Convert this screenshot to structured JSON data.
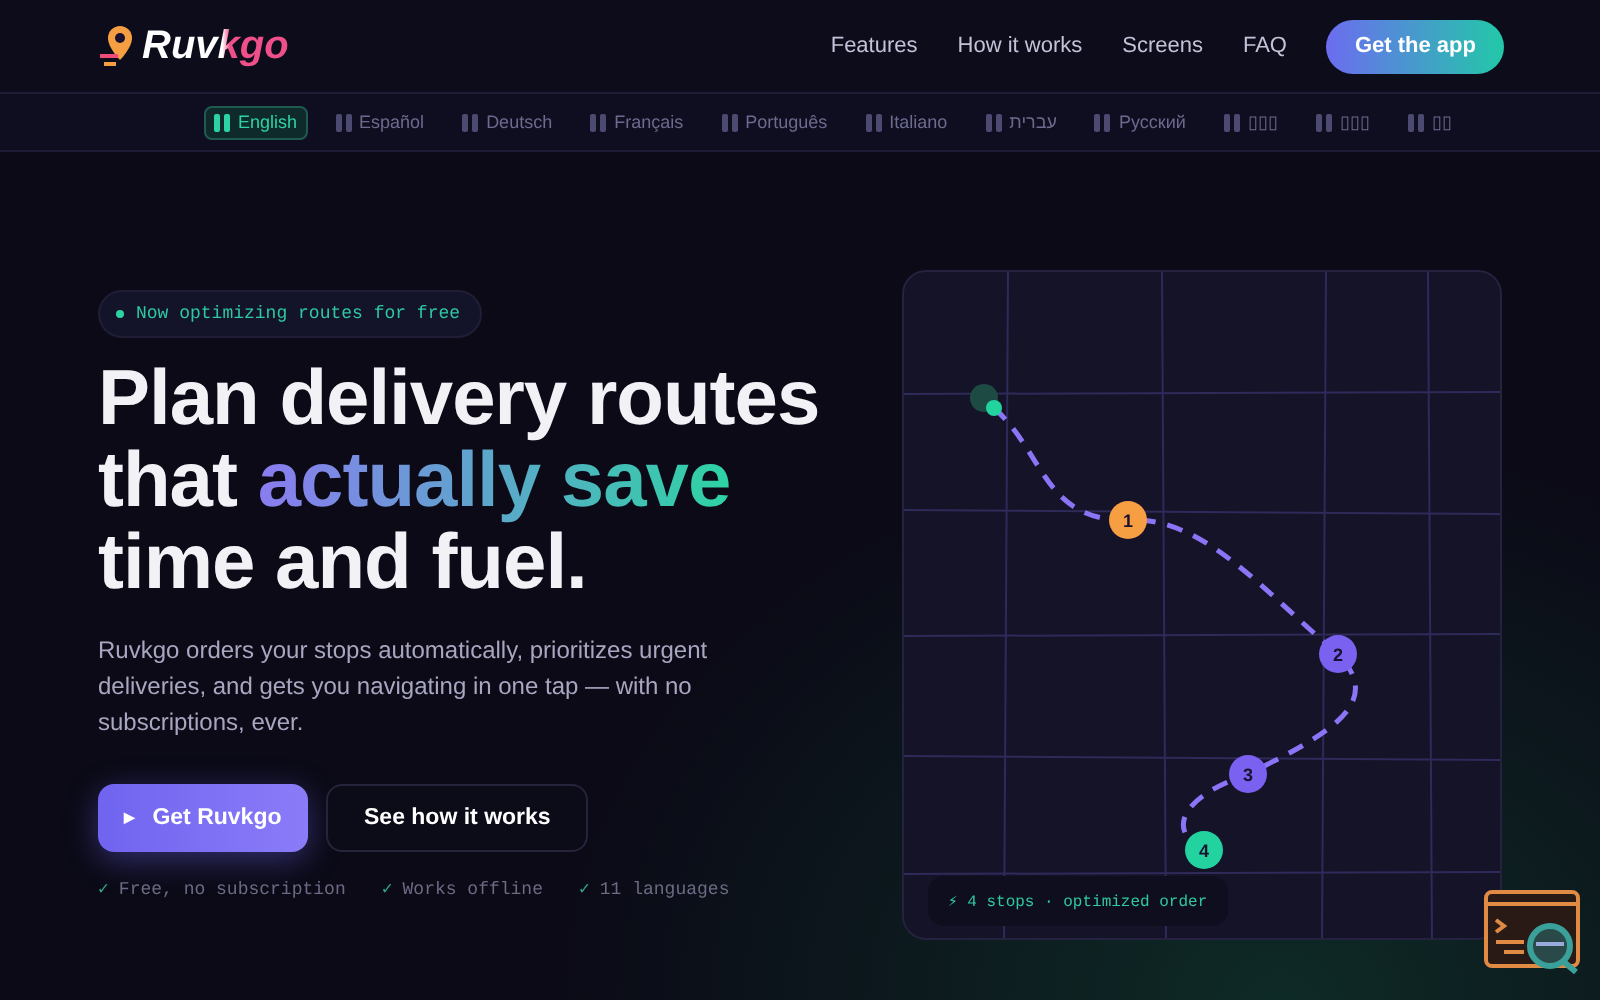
{
  "header": {
    "logo": "Ruvkgo",
    "nav": [
      {
        "label": "Features"
      },
      {
        "label": "How it works"
      },
      {
        "label": "Screens"
      },
      {
        "label": "FAQ"
      }
    ],
    "cta": "Get the app"
  },
  "languages": [
    {
      "label": "English",
      "selected": true
    },
    {
      "label": "Español",
      "selected": false
    },
    {
      "label": "Deutsch",
      "selected": false
    },
    {
      "label": "Français",
      "selected": false
    },
    {
      "label": "Português",
      "selected": false
    },
    {
      "label": "Italiano",
      "selected": false
    },
    {
      "label": "עברית",
      "selected": false
    },
    {
      "label": "Русский",
      "selected": false
    },
    {
      "label": "▯▯▯",
      "selected": false
    },
    {
      "label": "▯▯▯",
      "selected": false
    },
    {
      "label": "▯▯",
      "selected": false
    }
  ],
  "hero": {
    "badge": "Now optimizing routes for free",
    "title_line_1": "Plan delivery routes",
    "title_line_2_start": "that ",
    "title_highlight": "actually save",
    "title_line_3": "time and fuel.",
    "description": "Ruvkgo orders your stops automatically, prioritizes urgent deliveries, and gets you navigating in one tap — with no subscriptions, ever.",
    "primary_button": "Get Ruvkgo",
    "primary_icon": "▶",
    "secondary_button": "See how it works",
    "features": [
      {
        "check": "✓",
        "label": "Free, no subscription"
      },
      {
        "check": "✓",
        "label": "Works offline"
      },
      {
        "check": "✓",
        "label": "11 languages"
      }
    ]
  },
  "map": {
    "stops": [
      {
        "label": "1",
        "color": "#f59e42"
      },
      {
        "label": "2",
        "color": "#7b61f0"
      },
      {
        "label": "3",
        "color": "#7b61f0"
      },
      {
        "label": "4",
        "color": "#22d3a0"
      }
    ],
    "summary": "⚡ 4 stops · optimized order"
  }
}
